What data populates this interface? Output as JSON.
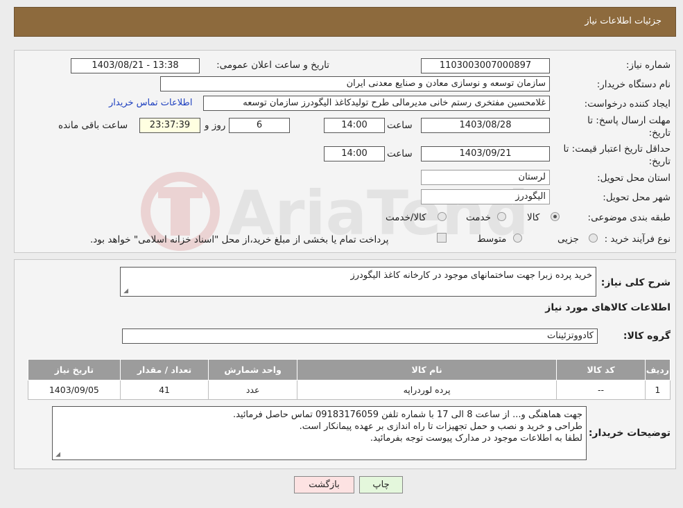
{
  "header": {
    "title": "جزئیات اطلاعات نیاز"
  },
  "info": {
    "need_number_label": "شماره نیاز:",
    "need_number": "1103003007000897",
    "announce_label": "تاریخ و ساعت اعلان عمومی:",
    "announce_value": "1403/08/21 - 13:38",
    "buyer_org_label": "نام دستگاه خریدار:",
    "buyer_org": "سازمان توسعه و نوسازی معادن و صنایع معدنی ایران",
    "creator_label": "ایجاد کننده درخواست:",
    "creator": "غلامحسین مفتخری رستم خانی مدیرمالی طرح تولیدکاغذ الیگودرز سازمان توسعه",
    "contact_link": "اطلاعات تماس خریدار",
    "deadline_label_1": "مهلت ارسال پاسخ: تا",
    "deadline_label_2": "تاریخ:",
    "deadline_date": "1403/08/28",
    "time_label": "ساعت",
    "deadline_time": "14:00",
    "days_value": "6",
    "days_label": "روز و",
    "remaining_time": "23:37:39",
    "remaining_label": "ساعت باقی مانده",
    "validity_label_1": "حداقل تاریخ اعتبار قیمت: تا",
    "validity_label_2": "تاریخ:",
    "validity_date": "1403/09/21",
    "validity_time": "14:00",
    "province_label": "استان محل تحویل:",
    "province": "لرستان",
    "city_label": "شهر محل تحویل:",
    "city": "الیگودرز",
    "category_label": "طبقه بندی موضوعی:",
    "category_options": [
      "کالا",
      "خدمت",
      "کالا/خدمت"
    ],
    "category_selected": "کالا",
    "purchase_type_label": "نوع فرآیند خرید :",
    "purchase_options": [
      "جزیی",
      "متوسط"
    ],
    "purchase_note": "پرداخت تمام یا بخشی از مبلغ خرید،از محل \"اسناد خزانه اسلامی\" خواهد بود."
  },
  "summary": {
    "label": "شرح کلی نیاز:",
    "text": "خرید پرده زبرا جهت ساختمانهای موجود در کارخانه کاغذ الیگودرز",
    "goods_section": "اطلاعات کالاهای مورد نیاز",
    "group_label": "گروه کالا:",
    "group_value": "کادووتزئینات"
  },
  "table": {
    "headers": [
      "ردیف",
      "کد کالا",
      "نام کالا",
      "واحد شمارش",
      "تعداد / مقدار",
      "تاریخ نیاز"
    ],
    "rows": [
      [
        "1",
        "--",
        "پرده لوردراپه",
        "عدد",
        "41",
        "1403/09/05"
      ]
    ]
  },
  "buyer_notes": {
    "label": "توضیحات خریدار:",
    "lines": [
      "جهت هماهنگی و... از ساعت 8 الی 17 با شماره تلفن 09183176059 تماس حاصل فرمائید.",
      "طراحی و خرید و نصب و حمل تجهیزات تا راه اندازی بر عهده پیمانکار است.",
      "لطفا به اطلاعات موجود در مدارک پیوست توجه بفرمائید."
    ]
  },
  "buttons": {
    "print": "چاپ",
    "back": "بازگشت"
  },
  "watermark": {
    "text": "AriaTender.neT"
  },
  "colors": {
    "header": "#8d6a3d",
    "table_header": "#9c9c9c",
    "back_button": "#fde2e2",
    "print_button": "#e4f7dc"
  }
}
